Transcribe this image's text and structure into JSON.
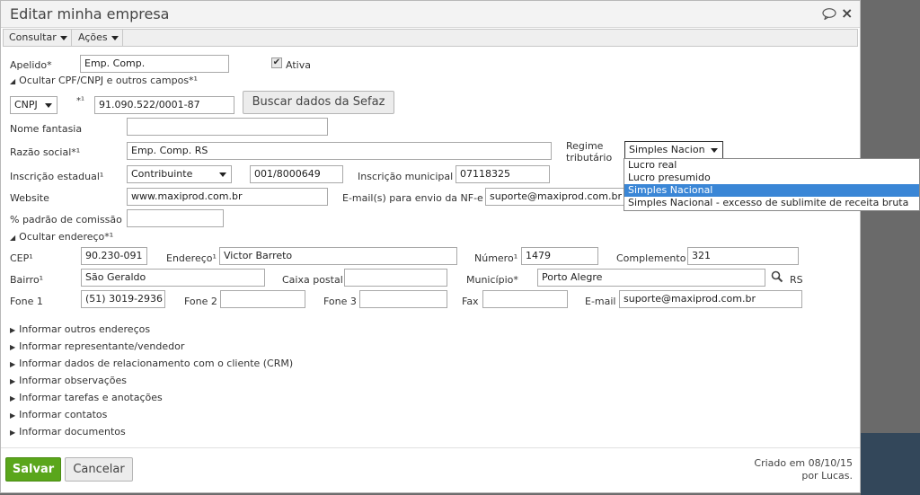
{
  "window": {
    "title": "Editar minha empresa"
  },
  "toolbar": {
    "consultar": "Consultar",
    "acoes": "Ações"
  },
  "form": {
    "apelido_label": "Apelido*",
    "apelido_value": "Emp. Comp.",
    "ativa_label": "Ativa",
    "ativa_checked": true,
    "ocultar_cpf": "Ocultar CPF/CNPJ e outros campos*¹",
    "doc_type": "CNPJ",
    "doc_marker": "*¹",
    "doc_value": "91.090.522/0001-87",
    "sefaz_button": "Buscar dados da Sefaz",
    "nome_fantasia_label": "Nome fantasia",
    "nome_fantasia_value": "",
    "razao_social_label": "Razão social*¹",
    "razao_social_value": "Emp. Comp. RS",
    "regime_label_1": "Regime",
    "regime_label_2": "tributário",
    "regime_value": "Simples Nacion",
    "regime_options": [
      "Lucro real",
      "Lucro presumido",
      "Simples Nacional",
      "Simples Nacional - excesso de sublimite de receita bruta"
    ],
    "ie_label": "Inscrição estadual¹",
    "ie_type": "Contribuinte",
    "ie_value": "001/8000649",
    "im_label": "Inscrição municipal",
    "im_value": "07118325",
    "website_label": "Website",
    "website_value": "www.maxiprod.com.br",
    "email_nfe_label": "E-mail(s) para envio da NF-e",
    "email_nfe_value": "suporte@maxiprod.com.br",
    "comissao_label": "% padrão de comissão",
    "comissao_value": "",
    "ocultar_endereco": "Ocultar endereço*¹",
    "cep_label": "CEP¹",
    "cep_value": "90.230-091",
    "endereco_label": "Endereço¹",
    "endereco_value": "Victor Barreto",
    "numero_label": "Número¹",
    "numero_value": "1479",
    "complemento_label": "Complemento",
    "complemento_value": "321",
    "bairro_label": "Bairro¹",
    "bairro_value": "São Geraldo",
    "caixa_postal_label": "Caixa postal",
    "caixa_postal_value": "",
    "municipio_label": "Município*",
    "municipio_value": "Porto Alegre",
    "uf": "RS",
    "fone1_label": "Fone 1",
    "fone1_value": "(51) 3019-2936",
    "fone2_label": "Fone 2",
    "fone2_value": "",
    "fone3_label": "Fone 3",
    "fone3_value": "",
    "fax_label": "Fax",
    "fax_value": "",
    "email_label": "E-mail",
    "email_value": "suporte@maxiprod.com.br"
  },
  "sections": [
    "Informar outros endereços",
    "Informar representante/vendedor",
    "Informar dados de relacionamento com o cliente (CRM)",
    "Informar observações",
    "Informar tarefas e anotações",
    "Informar contatos",
    "Informar documentos"
  ],
  "footer": {
    "save": "Salvar",
    "cancel": "Cancelar",
    "created_1": "Criado em 08/10/15",
    "created_2": "por Lucas."
  },
  "colors": {
    "save_green": "#5aa61b",
    "selected_blue": "#3a86d6"
  },
  "icons": [
    "chat-icon",
    "close-icon",
    "search-icon",
    "triangle-down-icon",
    "triangle-right-icon",
    "checkmark-icon"
  ]
}
